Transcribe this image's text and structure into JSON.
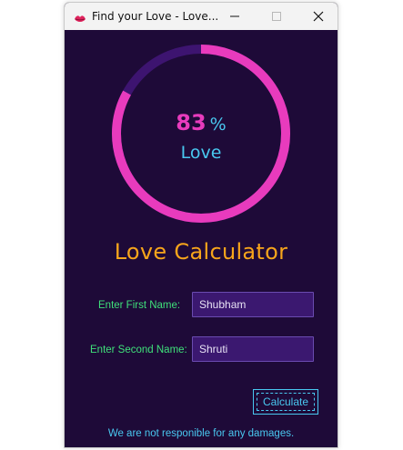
{
  "window": {
    "title": "Find your Love - Love...",
    "icon": "lips-icon",
    "controls": [
      "minimize-icon",
      "maximize-icon",
      "close-icon"
    ]
  },
  "gauge": {
    "percent_value": "83",
    "percent_sign": "%",
    "fill_fraction": 0.83,
    "caption": "Love",
    "colors": {
      "fill": "#e83bbd",
      "track": "#3d1470",
      "value": "#e83bbd",
      "caption": "#49c8f0"
    }
  },
  "heading": "Love Calculator",
  "form": {
    "first_label": "Enter First Name:",
    "first_value": "Shubham",
    "second_label": "Enter Second Name:",
    "second_value": "Shruti",
    "button_label": "Calculate"
  },
  "disclaimer": "We are not responible for any damages.",
  "colors": {
    "background": "#1e0a38",
    "heading": "#f7a51b",
    "label": "#3fe07a",
    "accent": "#49c8f0",
    "input_bg": "#3b1870"
  }
}
